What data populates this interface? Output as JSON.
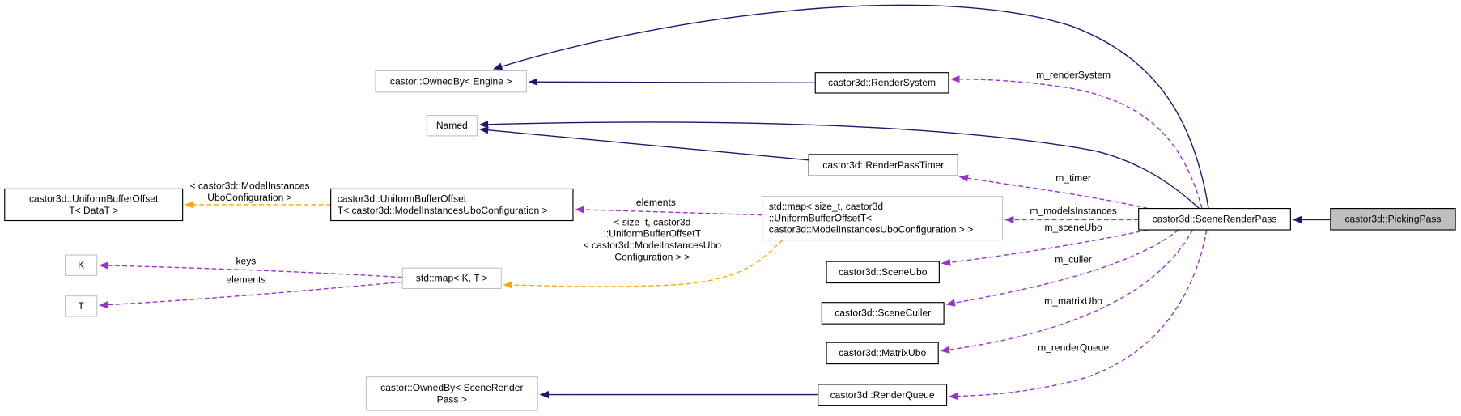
{
  "colors": {
    "inheritance": "#191970",
    "usage": "#9a32cd",
    "template": "#ffa500",
    "documented_border": "#000000",
    "undocumented_border": "#bfbfbf",
    "focus_fill": "#bfbfbf"
  },
  "nodes": {
    "ownedby_engine": {
      "lines": [
        "castor::OwnedBy< Engine >"
      ],
      "documented": false
    },
    "render_system": {
      "lines": [
        "castor3d::RenderSystem"
      ],
      "documented": true
    },
    "named": {
      "lines": [
        "Named"
      ],
      "documented": false
    },
    "render_pass_timer": {
      "lines": [
        "castor3d::RenderPassTimer"
      ],
      "documented": true
    },
    "ubo_offset_datat": {
      "lines": [
        "castor3d::UniformBufferOffset",
        "T< DataT >"
      ],
      "documented": true
    },
    "ubo_offset_model": {
      "lines": [
        "castor3d::UniformBufferOffset",
        "T< castor3d::ModelInstancesUboConfiguration >"
      ],
      "documented": true
    },
    "map_size_t": {
      "lines": [
        "std::map< size_t, castor3d",
        "::UniformBufferOffsetT<",
        " castor3d::ModelInstancesUboConfiguration > >"
      ],
      "documented": false
    },
    "scene_render_pass": {
      "lines": [
        "castor3d::SceneRenderPass"
      ],
      "documented": true
    },
    "picking_pass": {
      "lines": [
        "castor3d::PickingPass"
      ],
      "documented": true,
      "focus": true
    },
    "k": {
      "lines": [
        "K"
      ],
      "documented": false
    },
    "t": {
      "lines": [
        "T"
      ],
      "documented": false
    },
    "map_kt": {
      "lines": [
        "std::map< K, T >"
      ],
      "documented": false
    },
    "scene_ubo": {
      "lines": [
        "castor3d::SceneUbo"
      ],
      "documented": true
    },
    "scene_culler": {
      "lines": [
        "castor3d::SceneCuller"
      ],
      "documented": true
    },
    "matrix_ubo": {
      "lines": [
        "castor3d::MatrixUbo"
      ],
      "documented": true
    },
    "ownedby_scene_render_pass": {
      "lines": [
        "castor::OwnedBy< SceneRender",
        "Pass >"
      ],
      "documented": false
    },
    "render_queue": {
      "lines": [
        "castor3d::RenderQueue"
      ],
      "documented": true
    }
  },
  "edges": [
    {
      "id": "e1",
      "from": "scene_render_pass",
      "to": "ownedby_engine",
      "kind": "inheritance",
      "label": []
    },
    {
      "id": "e2",
      "from": "render_system",
      "to": "ownedby_engine",
      "kind": "inheritance",
      "label": []
    },
    {
      "id": "e3",
      "from": "scene_render_pass",
      "to": "named",
      "kind": "inheritance",
      "label": []
    },
    {
      "id": "e4",
      "from": "render_pass_timer",
      "to": "named",
      "kind": "inheritance",
      "label": []
    },
    {
      "id": "e5",
      "from": "picking_pass",
      "to": "scene_render_pass",
      "kind": "inheritance",
      "label": []
    },
    {
      "id": "e6",
      "from": "render_queue",
      "to": "ownedby_scene_render_pass",
      "kind": "inheritance",
      "label": []
    },
    {
      "id": "e7",
      "from": "scene_render_pass",
      "to": "render_system",
      "kind": "usage",
      "label": [
        "m_renderSystem"
      ]
    },
    {
      "id": "e8",
      "from": "scene_render_pass",
      "to": "render_pass_timer",
      "kind": "usage",
      "label": [
        "m_timer"
      ]
    },
    {
      "id": "e9",
      "from": "scene_render_pass",
      "to": "map_size_t",
      "kind": "usage",
      "label": [
        "m_modelsInstances"
      ]
    },
    {
      "id": "e10",
      "from": "scene_render_pass",
      "to": "scene_ubo",
      "kind": "usage",
      "label": [
        "m_sceneUbo"
      ]
    },
    {
      "id": "e11",
      "from": "scene_render_pass",
      "to": "scene_culler",
      "kind": "usage",
      "label": [
        "m_culler"
      ]
    },
    {
      "id": "e12",
      "from": "scene_render_pass",
      "to": "matrix_ubo",
      "kind": "usage",
      "label": [
        "m_matrixUbo"
      ]
    },
    {
      "id": "e13",
      "from": "scene_render_pass",
      "to": "render_queue",
      "kind": "usage",
      "label": [
        "m_renderQueue"
      ]
    },
    {
      "id": "e14",
      "from": "map_size_t",
      "to": "ubo_offset_model",
      "kind": "usage",
      "label": [
        "elements"
      ]
    },
    {
      "id": "e15",
      "from": "map_kt",
      "to": "k",
      "kind": "usage",
      "label": [
        "keys"
      ]
    },
    {
      "id": "e16",
      "from": "map_kt",
      "to": "t",
      "kind": "usage",
      "label": [
        "elements"
      ]
    },
    {
      "id": "e17",
      "from": "ubo_offset_model",
      "to": "ubo_offset_datat",
      "kind": "template",
      "label": [
        "< castor3d::ModelInstances",
        "UboConfiguration >"
      ]
    },
    {
      "id": "e18",
      "from": "map_size_t",
      "to": "map_kt",
      "kind": "template",
      "label": [
        "< size_t, castor3d",
        "::UniformBufferOffsetT",
        "< castor3d::ModelInstancesUbo",
        "Configuration > >"
      ]
    }
  ]
}
